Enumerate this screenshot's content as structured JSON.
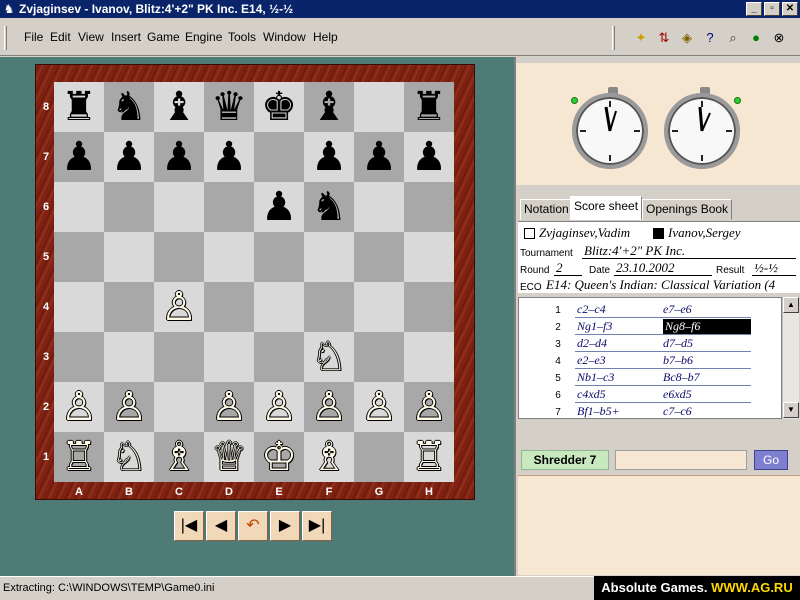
{
  "window": {
    "title": "Zvjaginsev - Ivanov, Blitz:4'+2\" PK Inc.  E14, ½-½",
    "minimize": "_",
    "maximize": "▫",
    "close": "✕"
  },
  "menu": [
    "File",
    "Edit",
    "View",
    "Insert",
    "Game",
    "Engine",
    "Tools",
    "Window",
    "Help"
  ],
  "toolbar_icons": [
    "new-icon",
    "flip-icon",
    "hint-icon",
    "help-icon",
    "search-icon",
    "ok-icon",
    "close-icon"
  ],
  "board": {
    "rows": [
      [
        "♜",
        "♞",
        "♝",
        "♛",
        "♚",
        "♝",
        "",
        "♜"
      ],
      [
        "♟",
        "♟",
        "♟",
        "♟",
        "",
        "♟",
        "♟",
        "♟"
      ],
      [
        "",
        "",
        "",
        "",
        "♟",
        "♞",
        "",
        ""
      ],
      [
        "",
        "",
        "",
        "",
        "",
        "",
        "",
        ""
      ],
      [
        "",
        "",
        "♙",
        "",
        "",
        "",
        "",
        ""
      ],
      [
        "",
        "",
        "",
        "",
        "",
        "♘",
        "",
        ""
      ],
      [
        "♙",
        "♙",
        "",
        "♙",
        "♙",
        "♙",
        "♙",
        "♙"
      ],
      [
        "♖",
        "♘",
        "♗",
        "♕",
        "♔",
        "♗",
        "",
        "♖"
      ]
    ],
    "ranks": [
      "8",
      "7",
      "6",
      "5",
      "4",
      "3",
      "2",
      "1"
    ],
    "files": [
      "A",
      "B",
      "C",
      "D",
      "E",
      "F",
      "G",
      "H"
    ]
  },
  "nav_buttons": [
    {
      "name": "first-move-button",
      "glyph": "|◀"
    },
    {
      "name": "prev-move-button",
      "glyph": "◀"
    },
    {
      "name": "takeback-button",
      "glyph": "↶"
    },
    {
      "name": "next-move-button",
      "glyph": "▶"
    },
    {
      "name": "last-move-button",
      "glyph": "▶|"
    }
  ],
  "tabs": [
    "Notation",
    "Score sheet",
    "Openings Book"
  ],
  "header": {
    "white": "Zvjaginsev,Vadim",
    "black": "Ivanov,Sergey",
    "tournament_label": "Tournament",
    "tournament": "Blitz:4'+2\" PK Inc.",
    "round_label": "Round",
    "round": "2",
    "date_label": "Date",
    "date": "23.10.2002",
    "result_label": "Result",
    "result": "½-½",
    "eco_label": "ECO",
    "eco": "E14: Queen's Indian: Classical Variation (4"
  },
  "moves": [
    {
      "n": "1",
      "w": "c2–c4",
      "b": "e7–e6"
    },
    {
      "n": "2",
      "w": "Ng1–f3",
      "b": "Ng8–f6"
    },
    {
      "n": "3",
      "w": "d2–d4",
      "b": "d7–d5"
    },
    {
      "n": "4",
      "w": "e2–e3",
      "b": "b7–b6"
    },
    {
      "n": "5",
      "w": "Nb1–c3",
      "b": "Bc8–b7"
    },
    {
      "n": "6",
      "w": "c4xd5",
      "b": "e6xd5"
    },
    {
      "n": "7",
      "w": "Bf1–b5+",
      "b": "c7–c6"
    }
  ],
  "engine": {
    "name": "Shredder 7",
    "go": "Go"
  },
  "status": "Extracting: C:\\WINDOWS\\TEMP\\Game0.ini",
  "watermark": {
    "left": "Absolute Games.",
    "right": "WWW.AG.RU"
  }
}
